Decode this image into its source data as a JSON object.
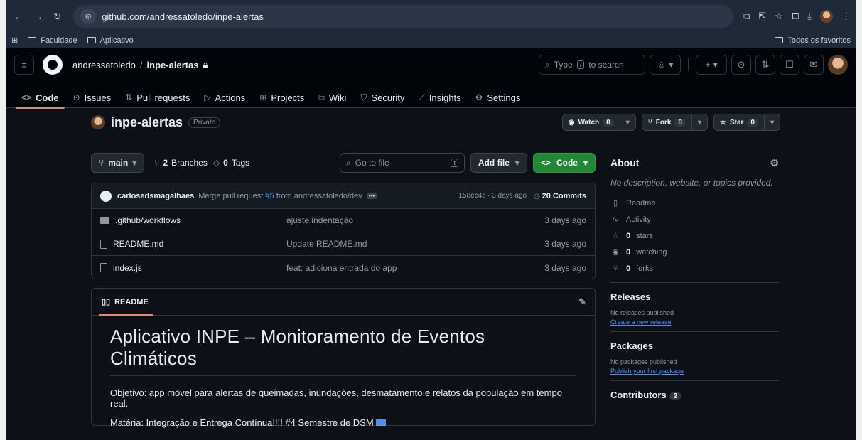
{
  "browser": {
    "url": "github.com/andressatoledo/inpe-alertas",
    "bookmarks": [
      "Faculdade",
      "Aplicativo"
    ],
    "bookmarks_right": "Todos os favoritos"
  },
  "header": {
    "owner": "andressatoledo",
    "repo": "inpe-alertas",
    "search_placeholder": "Type",
    "search_key": "/",
    "search_suffix": "to search"
  },
  "tabs": [
    {
      "label": "Code",
      "icon": "<>"
    },
    {
      "label": "Issues",
      "icon": "⊙"
    },
    {
      "label": "Pull requests",
      "icon": "⇅"
    },
    {
      "label": "Actions",
      "icon": "▷"
    },
    {
      "label": "Projects",
      "icon": "⊞"
    },
    {
      "label": "Wiki",
      "icon": "⧉"
    },
    {
      "label": "Security",
      "icon": "⛉"
    },
    {
      "label": "Insights",
      "icon": "⟋"
    },
    {
      "label": "Settings",
      "icon": "⚙"
    }
  ],
  "repo": {
    "name": "inpe-alertas",
    "visibility": "Private",
    "watch_label": "Watch",
    "watch_count": "0",
    "fork_label": "Fork",
    "fork_count": "0",
    "star_label": "Star",
    "star_count": "0"
  },
  "toolbar": {
    "branch": "main",
    "branches_count": "2",
    "branches_label": "Branches",
    "tags_count": "0",
    "tags_label": "Tags",
    "goto_placeholder": "Go to file",
    "goto_key": "t",
    "add_file": "Add file",
    "code": "Code"
  },
  "commit": {
    "author": "carlosedsmagalhaes",
    "message_prefix": "Merge pull request",
    "pr": "#5",
    "message_suffix": "from andressatoledo/dev",
    "hash_age": "158ec4c · 3 days ago",
    "commits": "20 Commits"
  },
  "files": [
    {
      "name": ".github/workflows",
      "type": "dir",
      "message": "ajuste indentação",
      "date": "3 days ago"
    },
    {
      "name": "README.md",
      "type": "file",
      "message": "Update README.md",
      "date": "3 days ago"
    },
    {
      "name": "index.js",
      "type": "file",
      "message": "feat: adiciona entrada do app",
      "date": "3 days ago"
    }
  ],
  "readme": {
    "tab_label": "README",
    "title": "Aplicativo INPE – Monitoramento de Eventos Climáticos",
    "p1": "Objetivo: app móvel para alertas de queimadas, inundações, desmatamento e relatos da população em tempo real.",
    "p2": "Matéria: Integração e Entrega Contínua!!!! #4 Semestre de DSM"
  },
  "about": {
    "title": "About",
    "description": "No description, website, or topics provided.",
    "readme": "Readme",
    "activity": "Activity",
    "stars_count": "0",
    "stars_label": "stars",
    "watching_count": "0",
    "watching_label": "watching",
    "forks_count": "0",
    "forks_label": "forks"
  },
  "releases": {
    "title": "Releases",
    "none": "No releases published",
    "link": "Create a new release"
  },
  "packages": {
    "title": "Packages",
    "none": "No packages published",
    "link": "Publish your first package"
  },
  "contributors": {
    "title": "Contributors",
    "count": "2"
  },
  "colors": {
    "accent_green": "#238636",
    "tab_underline": "#f78166",
    "link": "#4493f8",
    "bg": "#0d1117"
  }
}
